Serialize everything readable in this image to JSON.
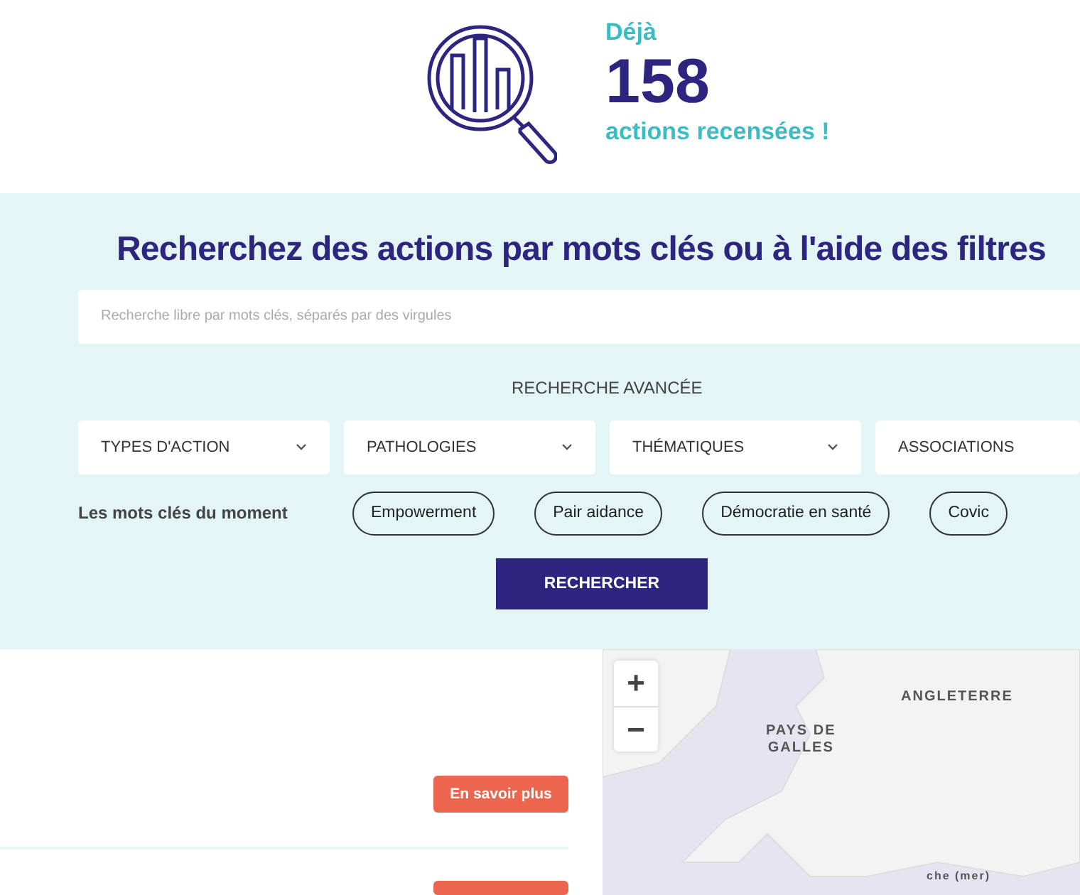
{
  "counter": {
    "prefix": "Déjà",
    "count": "158",
    "suffix": "actions recensées !"
  },
  "search": {
    "title": "Recherchez des actions par mots clés ou à l'aide des filtres",
    "placeholder": "Recherche libre par mots clés, séparés par des virgules",
    "advanced_label": "RECHERCHE AVANCÉE",
    "filters": [
      {
        "label": "TYPES D'ACTION"
      },
      {
        "label": "PATHOLOGIES"
      },
      {
        "label": "THÉMATIQUES"
      },
      {
        "label": "ASSOCIATIONS"
      }
    ],
    "keywords_label": "Les mots clés du moment",
    "keywords": [
      "Empowerment",
      "Pair aidance",
      "Démocratie en santé",
      "Covic"
    ],
    "submit": "RECHERCHER"
  },
  "results": [
    {
      "kind": "full",
      "button": "En savoir plus"
    },
    {
      "kind": "stub"
    }
  ],
  "map": {
    "zoom_in": "+",
    "zoom_out": "−",
    "labels": [
      {
        "text": "ANGLETERRE"
      },
      {
        "text": "PAYS DE GALLES"
      },
      {
        "text": "che (mer)"
      }
    ]
  }
}
